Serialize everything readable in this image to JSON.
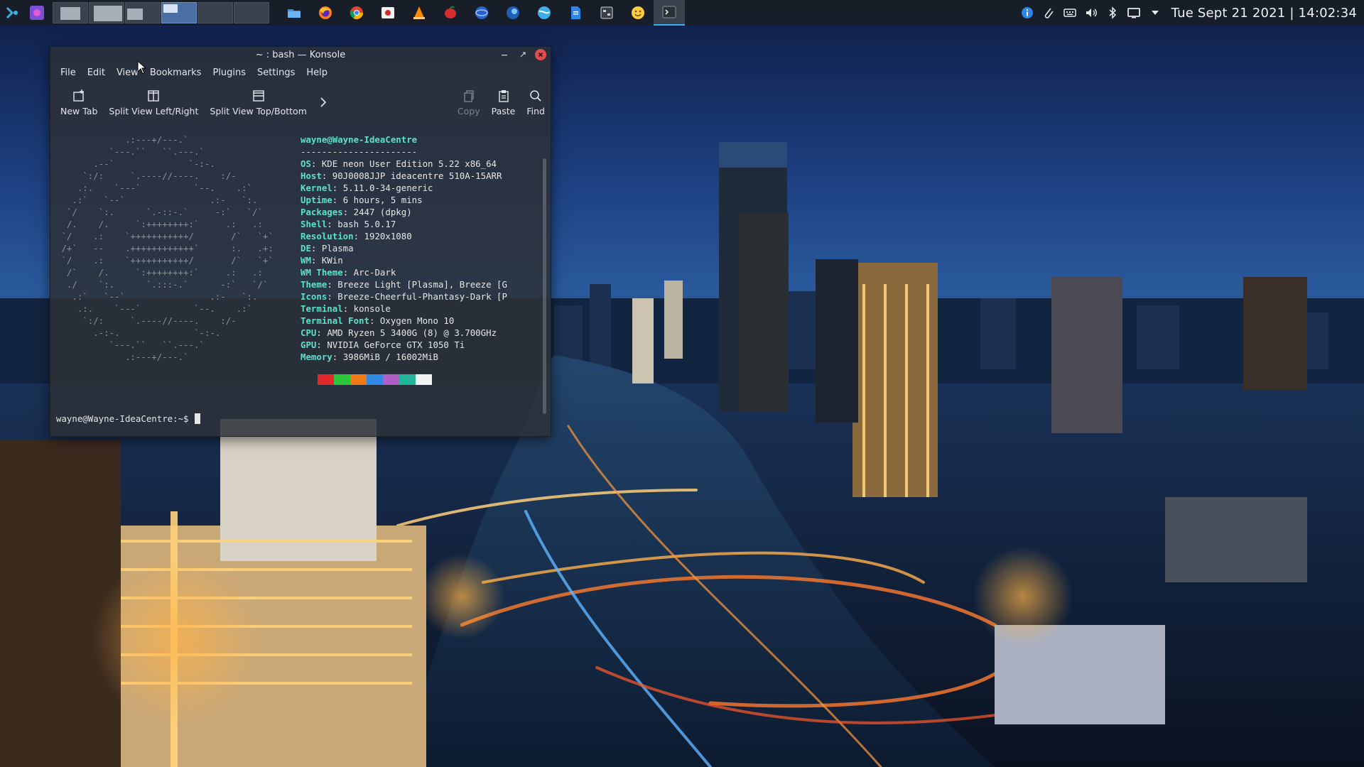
{
  "panel": {
    "tasks": [
      {
        "icon": "dolphin-file-manager-icon"
      },
      {
        "icon": "firefox-icon"
      },
      {
        "icon": "chrome-icon"
      },
      {
        "icon": "image-viewer-icon"
      },
      {
        "icon": "vlc-icon"
      },
      {
        "icon": "red-app-icon"
      },
      {
        "icon": "blue-globe-app-icon"
      },
      {
        "icon": "blue-bird-app-icon"
      },
      {
        "icon": "web-browser-icon"
      },
      {
        "icon": "document-icon"
      },
      {
        "icon": "system-settings-icon"
      },
      {
        "icon": "emoji-app-icon"
      },
      {
        "icon": "konsole-icon",
        "active": true
      }
    ],
    "tray": [
      "info-icon",
      "clipboard-icon",
      "keyboard-icon",
      "volume-icon",
      "bluetooth-icon",
      "display-icon",
      "expand-tray-icon"
    ],
    "clock": "Tue Sept 21 2021 | 14:02:34"
  },
  "window": {
    "title": "~ : bash — Konsole",
    "menu": [
      "File",
      "Edit",
      "View",
      "Bookmarks",
      "Plugins",
      "Settings",
      "Help"
    ],
    "toolbar": {
      "new_tab": "New Tab",
      "split_lr": "Split View Left/Right",
      "split_tb": "Split View Top/Bottom",
      "copy": "Copy",
      "paste": "Paste",
      "find": "Find"
    }
  },
  "terminal": {
    "user_host": "wayne@Wayne-IdeaCentre",
    "separator": "----------------------",
    "info": [
      {
        "key": "OS",
        "value": "KDE neon User Edition 5.22 x86_64"
      },
      {
        "key": "Host",
        "value": "90J0008JJP ideacentre 510A-15ARR"
      },
      {
        "key": "Kernel",
        "value": "5.11.0-34-generic"
      },
      {
        "key": "Uptime",
        "value": "6 hours, 5 mins"
      },
      {
        "key": "Packages",
        "value": "2447 (dpkg)"
      },
      {
        "key": "Shell",
        "value": "bash 5.0.17"
      },
      {
        "key": "Resolution",
        "value": "1920x1080"
      },
      {
        "key": "DE",
        "value": "Plasma"
      },
      {
        "key": "WM",
        "value": "KWin"
      },
      {
        "key": "WM Theme",
        "value": "Arc-Dark"
      },
      {
        "key": "Theme",
        "value": "Breeze Light [Plasma], Breeze [G"
      },
      {
        "key": "Icons",
        "value": "Breeze-Cheerful-Phantasy-Dark [P"
      },
      {
        "key": "Terminal",
        "value": "konsole"
      },
      {
        "key": "Terminal Font",
        "value": "Oxygen Mono 10"
      },
      {
        "key": "CPU",
        "value": "AMD Ryzen 5 3400G (8) @ 3.700GHz"
      },
      {
        "key": "GPU",
        "value": "NVIDIA GeForce GTX 1050 Ti"
      },
      {
        "key": "Memory",
        "value": "3986MiB / 16002MiB"
      }
    ],
    "color_swatches": [
      "#e0282d",
      "#2bc43a",
      "#f07b16",
      "#2f8ae3",
      "#b05ec8",
      "#22b59a",
      "#f2f2f2"
    ],
    "ascii_logo": "             .:---+/---.`\n          `---.``   ``.---.`\n       .--`              `-:-.\n     `:/:     `.----//----.    :/-\n    .:.    `---`          `--.    .:`\n   .:`   `--`                .:-   `:.\n  `/    `:.      `.-::-.`     -:`   `/`\n  /.    /.     `:++++++++:`     .:   .:\n `/    .:    `+++++++++++/       /`   `+`\n /+`   --    .++++++++++++`      :.   .+:\n `/    .:    `+++++++++++/       /`   `+`\n  /`    /.     `:++++++++:`     .:   .:\n  ./    `:.      `.:::-.`      -:`   `/`\n   .:`   `--`                .:-   `:.\n    .:.    `---`          `--.    .:`\n     `:/:     `.----//----.    :/-\n       .-:-.              `-:-.\n          `---.``   ``.---.`\n             .:---+/---.`",
    "prompt": "wayne@Wayne-IdeaCentre:~$ "
  }
}
